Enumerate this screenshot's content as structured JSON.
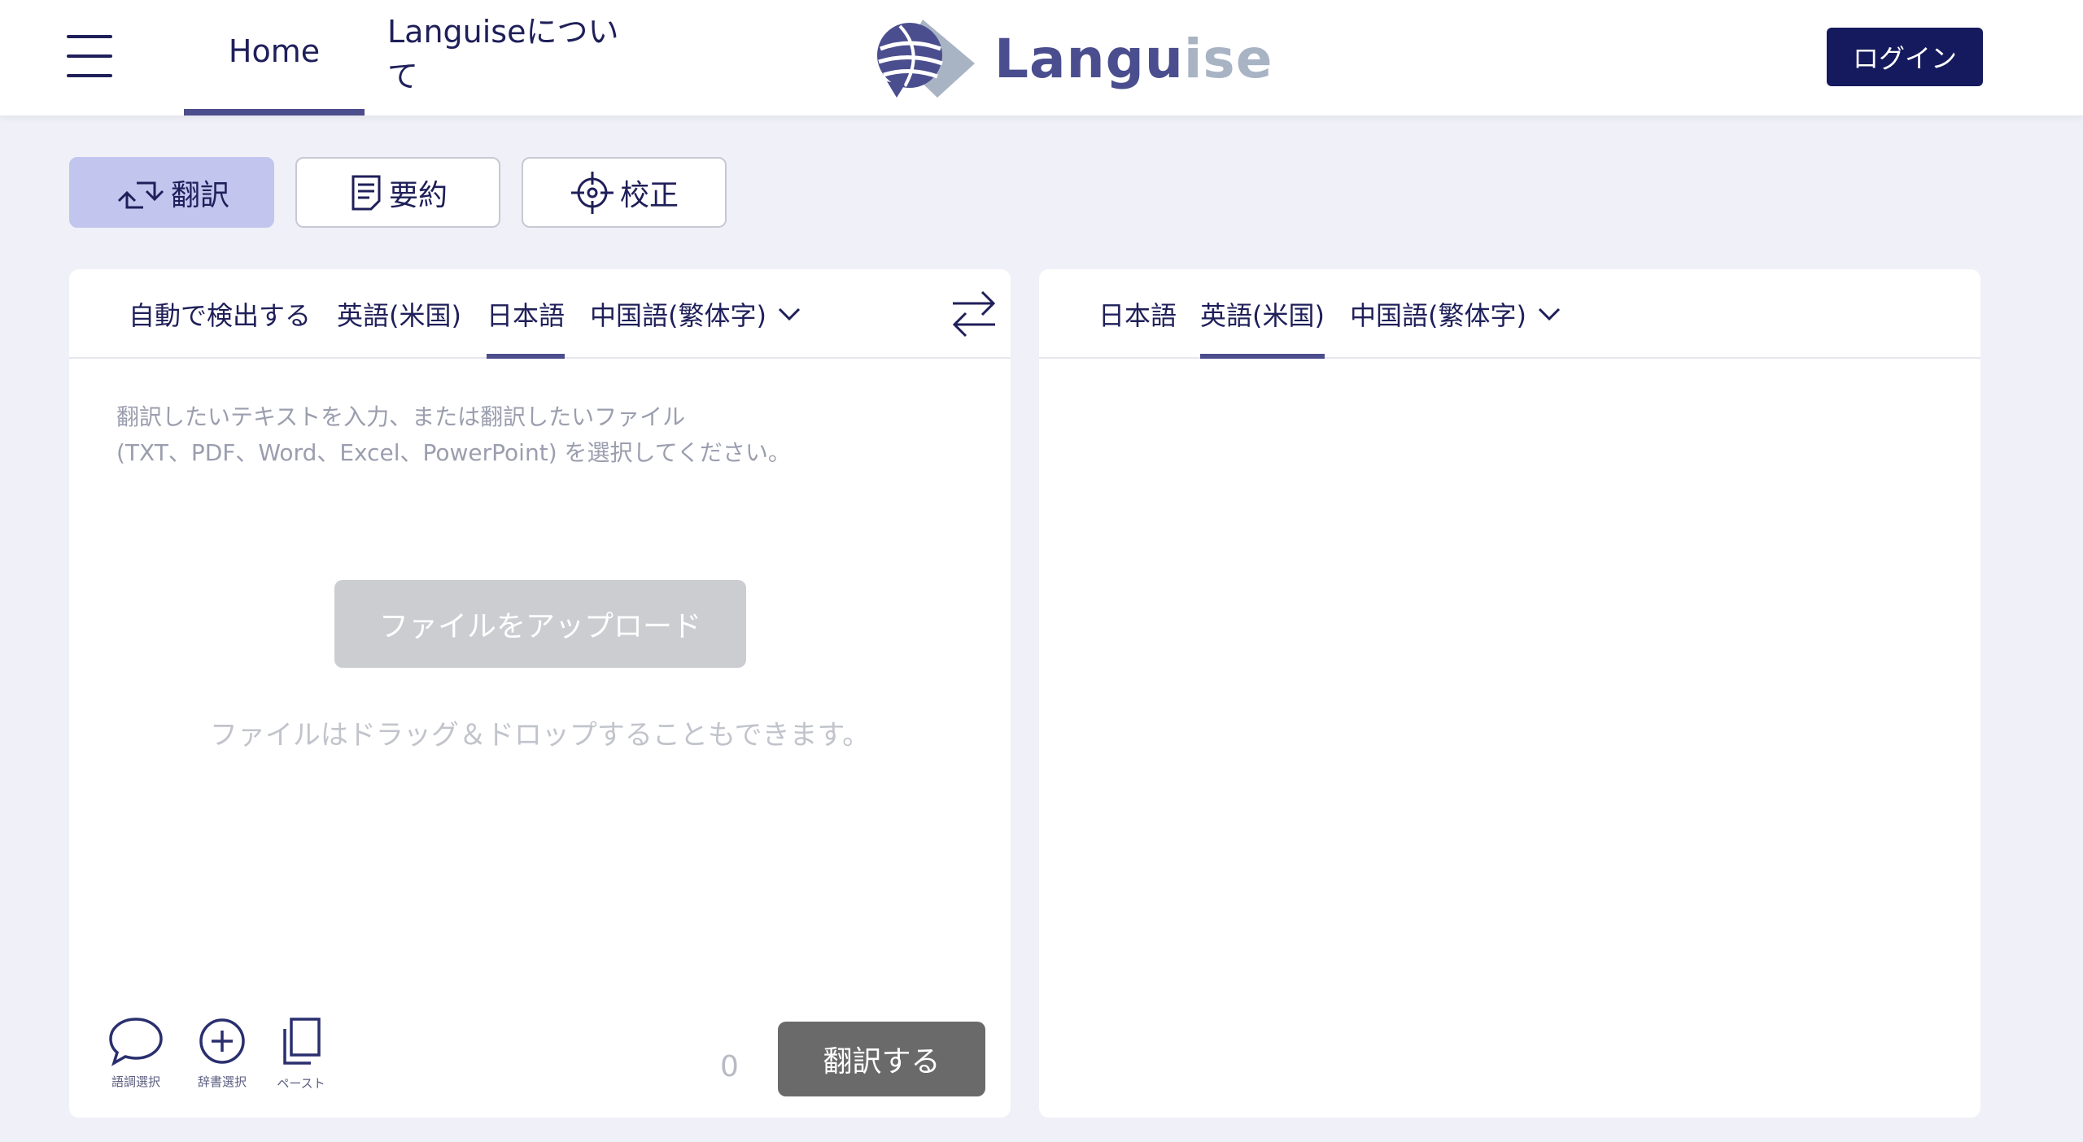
{
  "header": {
    "nav": {
      "home": "Home",
      "about": "Languiseについて"
    },
    "logo": {
      "part1": "Langu",
      "part2": "ise"
    },
    "login_label": "ログイン"
  },
  "modes": {
    "translate": "翻訳",
    "summary": "要約",
    "proofread": "校正",
    "active": "translate"
  },
  "source_panel": {
    "languages": [
      "自動で検出する",
      "英語(米国)",
      "日本語"
    ],
    "more_language": "中国語(繁体字)",
    "active_language": "日本語",
    "placeholder_line1": "翻訳したいテキストを入力、または翻訳したいファイル",
    "placeholder_line2": "(TXT、PDF、Word、Excel、PowerPoint) を選択してください。",
    "upload_label": "ファイルをアップロード",
    "drop_hint": "ファイルはドラッグ＆ドロップすることもできます。",
    "tools": {
      "tone": "語調選択",
      "dictionary": "辞書選択",
      "paste": "ペースト"
    },
    "char_count": "0",
    "translate_button": "翻訳する"
  },
  "target_panel": {
    "languages": [
      "日本語",
      "英語(米国)"
    ],
    "more_language": "中国語(繁体字)",
    "active_language": "英語(米国)"
  },
  "colors": {
    "navy": "#151a5e",
    "text": "#1f1f5a",
    "active_mode_bg": "#c2c5ee",
    "underline": "#4b4d8c",
    "page_bg": "#f0f0f8",
    "disabled_button": "#cbcdd0",
    "translate_button": "#6a6a6a"
  },
  "icons": {
    "menu": "hamburger-icon",
    "swap": "swap-arrows-icon",
    "translate": "translate-arrows-icon",
    "summary": "document-icon",
    "proofread": "crosshair-icon",
    "tone": "speech-bubble-icon",
    "dictionary": "plus-circle-icon",
    "paste": "copy-icon",
    "dropdown": "chevron-down-icon"
  }
}
